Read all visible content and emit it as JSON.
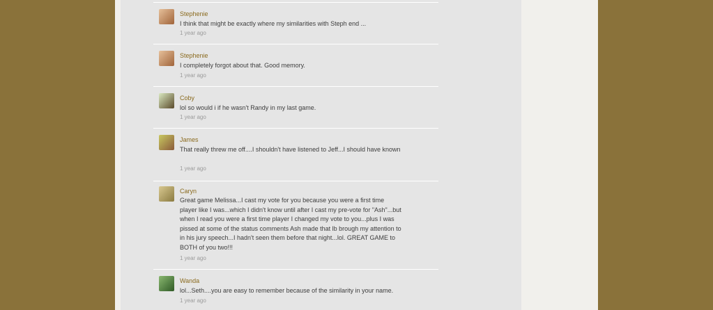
{
  "comments": [
    {
      "author": "Stephenie",
      "text": "I think that might be exactly where my similarities with Steph end ...",
      "time": "1 year ago",
      "avatar_color": "#c08a5a"
    },
    {
      "author": "Stephenie",
      "text": "I completely forgot about that. Good memory.",
      "time": "1 year ago",
      "avatar_color": "#c08a5a"
    },
    {
      "author": "Coby",
      "text": "lol  so would i if he wasn't Randy in my last game.",
      "time": "1 year ago",
      "avatar_color": "#6f7a52"
    },
    {
      "author": "James",
      "text": "That really threw me off....I shouldn't have listened to Jeff...I should have known",
      "time": "1 year ago",
      "avatar_color": "#9a9a3a"
    },
    {
      "author": "Caryn",
      "text": "Great game Melissa...I cast my vote for you because you were a first time player like I was...which I didn't know until after I cast my pre-vote for \"Ash\"...but when I read you were a first time player I changed my vote to you...plus I was pissed at some of the status comments Ash made that lb brough my attention to in his jury speech...I hadn't seen them before that night...lol.  GREAT GAME to BOTH of you two!!!",
      "time": "1 year ago",
      "avatar_color": "#b8a46a"
    },
    {
      "author": "Wanda",
      "text": "lol...Seth....you are easy to remember because of the similarity in your name.",
      "time": "1 year ago",
      "avatar_color": "#4e7a3a"
    }
  ]
}
